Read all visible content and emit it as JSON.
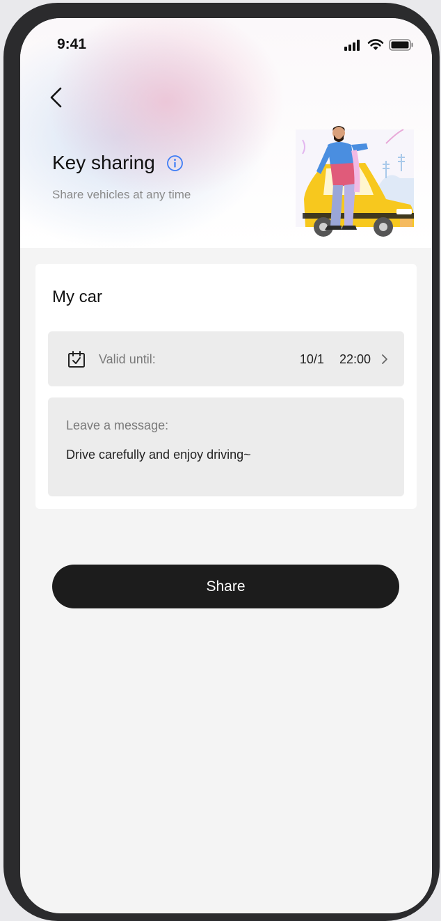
{
  "status_bar": {
    "time": "9:41",
    "icons": [
      "cellular-signal-icon",
      "wifi-icon",
      "battery-icon"
    ]
  },
  "header": {
    "back_icon": "chevron-left-icon",
    "title": "Key sharing",
    "info_icon": "info-circle-icon",
    "subtitle": "Share vehicles at any time",
    "illustration": "man-leaning-on-yellow-car-illustration"
  },
  "card": {
    "title": "My car",
    "valid": {
      "icon": "calendar-check-icon",
      "label": "Valid until:",
      "value": "10/1  22:00",
      "chevron_icon": "chevron-right-icon"
    },
    "message": {
      "label": "Leave a message:",
      "text": "Drive carefully and enjoy driving~"
    }
  },
  "actions": {
    "share_label": "Share"
  },
  "colors": {
    "accent_info": "#3d7cf5",
    "button_bg": "#1c1c1c",
    "page_bg": "#f4f4f4",
    "field_bg": "#ececec"
  }
}
